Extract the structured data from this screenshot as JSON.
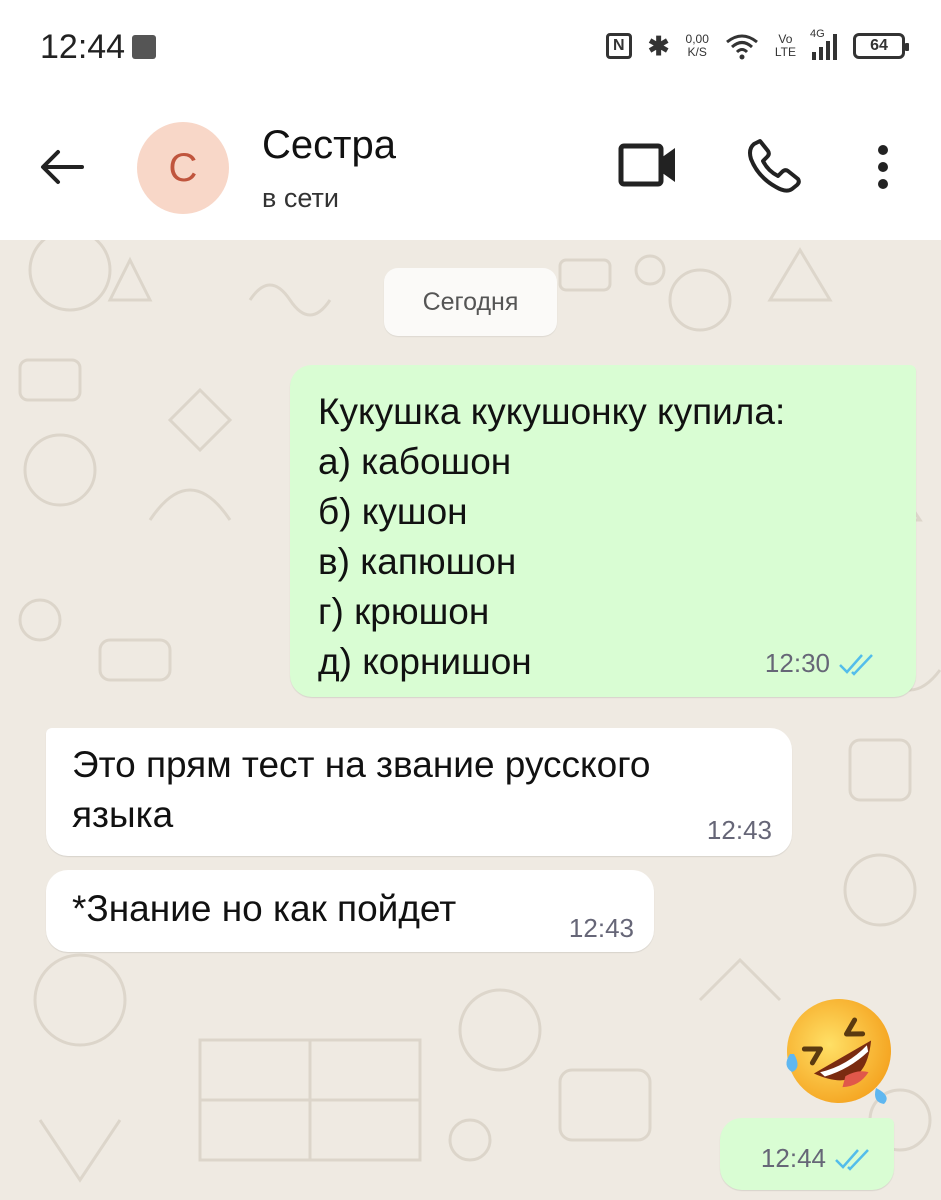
{
  "status_bar": {
    "time": "12:44",
    "nfc": "N",
    "bluetooth": "✱",
    "speed_value": "0,00",
    "speed_unit": "K/S",
    "volte_top": "Vo",
    "volte_bottom": "LTE",
    "network": "4G",
    "battery": "64"
  },
  "header": {
    "avatar_letter": "С",
    "contact_name": "Сестра",
    "contact_status": "в сети",
    "icons": [
      "back-arrow-icon",
      "video-camera-icon",
      "phone-icon",
      "more-vert-icon"
    ]
  },
  "chat": {
    "date_label": "Сегодня",
    "messages": [
      {
        "direction": "outgoing",
        "text": "Кукушка кукушонку купила:\nа) кабошон\nб) кушон\nв) капюшон\nг) крюшон\nд) корнишон",
        "time": "12:30",
        "read": true
      },
      {
        "direction": "incoming",
        "text": "Это прям тест на звание русского\nязыка",
        "time": "12:43"
      },
      {
        "direction": "incoming",
        "text": "*Знание но как пойдет",
        "time": "12:43"
      },
      {
        "direction": "outgoing",
        "emoji": "rolling-on-floor-laughing",
        "time": "12:44",
        "read": true
      }
    ]
  },
  "colors": {
    "outgoing_bubble": "#d9fdd3",
    "incoming_bubble": "#ffffff",
    "chat_background": "#efeae2",
    "read_ticks": "#53bdeb",
    "avatar_bg": "#f8d7c8",
    "avatar_fg": "#c0553d"
  }
}
